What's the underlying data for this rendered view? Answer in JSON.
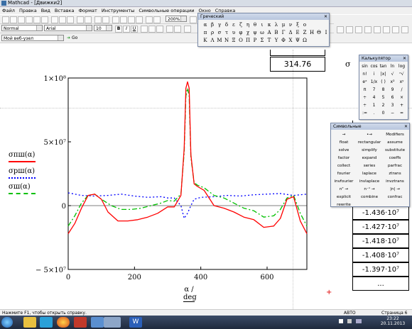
{
  "window": {
    "title": "Mathcad - [Движки2]"
  },
  "menu": [
    "Файл",
    "Правка",
    "Вид",
    "Вставка",
    "Формат",
    "Инструменты",
    "Символьные операции",
    "Окно",
    "Справка"
  ],
  "toolbar": {
    "style": "Normal",
    "font": "Arial",
    "size": "10",
    "zoom": "200%",
    "address": "Мой веб-узел",
    "go": "Go"
  },
  "greek": {
    "title": "Греческий",
    "row1": [
      "α",
      "β",
      "γ",
      "δ",
      "ε",
      "ζ",
      "η",
      "θ",
      "ι",
      "κ",
      "λ",
      "μ",
      "ν",
      "ξ",
      "ο"
    ],
    "row2": [
      "π",
      "ρ",
      "σ",
      "τ",
      "υ",
      "φ",
      "χ",
      "ψ",
      "ω",
      "Α",
      "Β",
      "Γ",
      "Δ",
      "Ε",
      "Ζ",
      "Η",
      "Θ",
      "Ι"
    ],
    "row3": [
      "Κ",
      "Λ",
      "Μ",
      "Ν",
      "Ξ",
      "Ο",
      "Π",
      "Ρ",
      "Σ",
      "Τ",
      "Υ",
      "Φ",
      "Χ",
      "Ψ",
      "Ω"
    ]
  },
  "calculator": {
    "title": "Калькулятор",
    "rows": [
      [
        "sin",
        "cos",
        "tan",
        "ln",
        "log"
      ],
      [
        "n!",
        "i",
        "|x|",
        "√",
        "ⁿ√"
      ],
      [
        "eˣ",
        "1/x",
        "( )",
        "x²",
        "xʸ"
      ],
      [
        "π",
        "7",
        "8",
        "9",
        "/"
      ],
      [
        "÷",
        "4",
        "5",
        "6",
        "×"
      ],
      [
        "÷",
        "1",
        "2",
        "3",
        "+"
      ],
      [
        ":=",
        ".",
        "0",
        "−",
        "="
      ]
    ]
  },
  "symbolic": {
    "title": "Символьные",
    "items": [
      "→",
      "•→",
      "Modifiers",
      "float",
      "rectangular",
      "assume",
      "solve",
      "simplify",
      "substitute",
      "factor",
      "expand",
      "coeffs",
      "collect",
      "series",
      "parfrac",
      "fourier",
      "laplace",
      "ztrans",
      "invfourier",
      "invlaplace",
      "invztrans",
      "nᵀ →",
      "n⁻¹ →",
      "|n| →",
      "explicit",
      "combine",
      "confrac",
      "rewrite"
    ]
  },
  "results": {
    "top_value": "314.76",
    "sigma": "σ",
    "values": [
      "-1.436·10⁷",
      "-1.427·10⁷",
      "-1.418·10⁷",
      "-1.408·10⁷",
      "-1.397·10⁷",
      "..."
    ]
  },
  "legend": [
    {
      "label": "σпш(α)",
      "color": "#ff0000",
      "dash": "solid"
    },
    {
      "label": "σрш(α)",
      "color": "#0000ff",
      "dash": "dot"
    },
    {
      "label": "σш(α)",
      "color": "#00c000",
      "dash": "dash"
    }
  ],
  "chart_data": {
    "type": "line",
    "xlabel": "α / deg",
    "xticks": [
      "0",
      "200",
      "400",
      "600"
    ],
    "yticks": [
      "1×10⁸",
      "5×10⁷",
      "0",
      "− 5×10⁷"
    ],
    "xlim": [
      0,
      720
    ],
    "ylim": [
      -50000000,
      100000000
    ],
    "series": [
      {
        "name": "σпш(α)",
        "x": [
          0,
          20,
          40,
          60,
          80,
          100,
          120,
          150,
          180,
          210,
          240,
          270,
          300,
          320,
          340,
          350,
          355,
          360,
          365,
          370,
          380,
          390,
          410,
          440,
          470,
          500,
          530,
          560,
          590,
          620,
          640,
          660,
          680,
          700,
          720
        ],
        "y": [
          -22000000,
          -14000000,
          -2000000,
          8000000,
          9000000,
          5000000,
          -5000000,
          -12000000,
          -12000000,
          -11000000,
          -9000000,
          -6000000,
          -1000000,
          -1000000,
          8000000,
          45000000,
          92000000,
          97000000,
          92000000,
          40000000,
          17000000,
          15000000,
          12000000,
          0,
          -2000000,
          -5000000,
          -9000000,
          -11000000,
          -17000000,
          -16000000,
          -10000000,
          5000000,
          7000000,
          -12000000,
          -22000000
        ]
      },
      {
        "name": "σрш(α)",
        "x": [
          0,
          40,
          80,
          120,
          160,
          200,
          240,
          280,
          300,
          320,
          340,
          350,
          360,
          370,
          380,
          400,
          440,
          480,
          520,
          560,
          600,
          640,
          680,
          720
        ],
        "y": [
          10000000,
          8000000,
          7500000,
          8000000,
          9000000,
          7500000,
          6500000,
          7000000,
          6000000,
          6000000,
          0,
          -10000000,
          -6000000,
          0,
          5000000,
          6500000,
          7000000,
          8000000,
          7500000,
          8500000,
          9000000,
          9500000,
          8000000,
          9000000
        ]
      },
      {
        "name": "σш(α)",
        "x": [
          0,
          20,
          40,
          60,
          80,
          100,
          130,
          160,
          190,
          220,
          250,
          280,
          300,
          320,
          340,
          350,
          355,
          360,
          365,
          370,
          380,
          390,
          410,
          440,
          470,
          500,
          530,
          560,
          590,
          620,
          640,
          660,
          680,
          700,
          720
        ],
        "y": [
          -16000000,
          -8000000,
          2000000,
          8000000,
          9000000,
          5000000,
          0,
          -3000000,
          -3000000,
          -2000000,
          0,
          2000000,
          4000000,
          3500000,
          9000000,
          42000000,
          86000000,
          92000000,
          86000000,
          38000000,
          18000000,
          16000000,
          14000000,
          8000000,
          6000000,
          2000000,
          -2000000,
          -4000000,
          -9000000,
          -8000000,
          -3000000,
          6000000,
          8000000,
          -6000000,
          -16000000
        ]
      }
    ]
  },
  "status": {
    "help": "Нажмите F1, чтобы открыть справку.",
    "mode": "АВТО",
    "page": "Страница 6"
  },
  "taskbar": {
    "time": "23:22",
    "date": "20.11.2013"
  }
}
